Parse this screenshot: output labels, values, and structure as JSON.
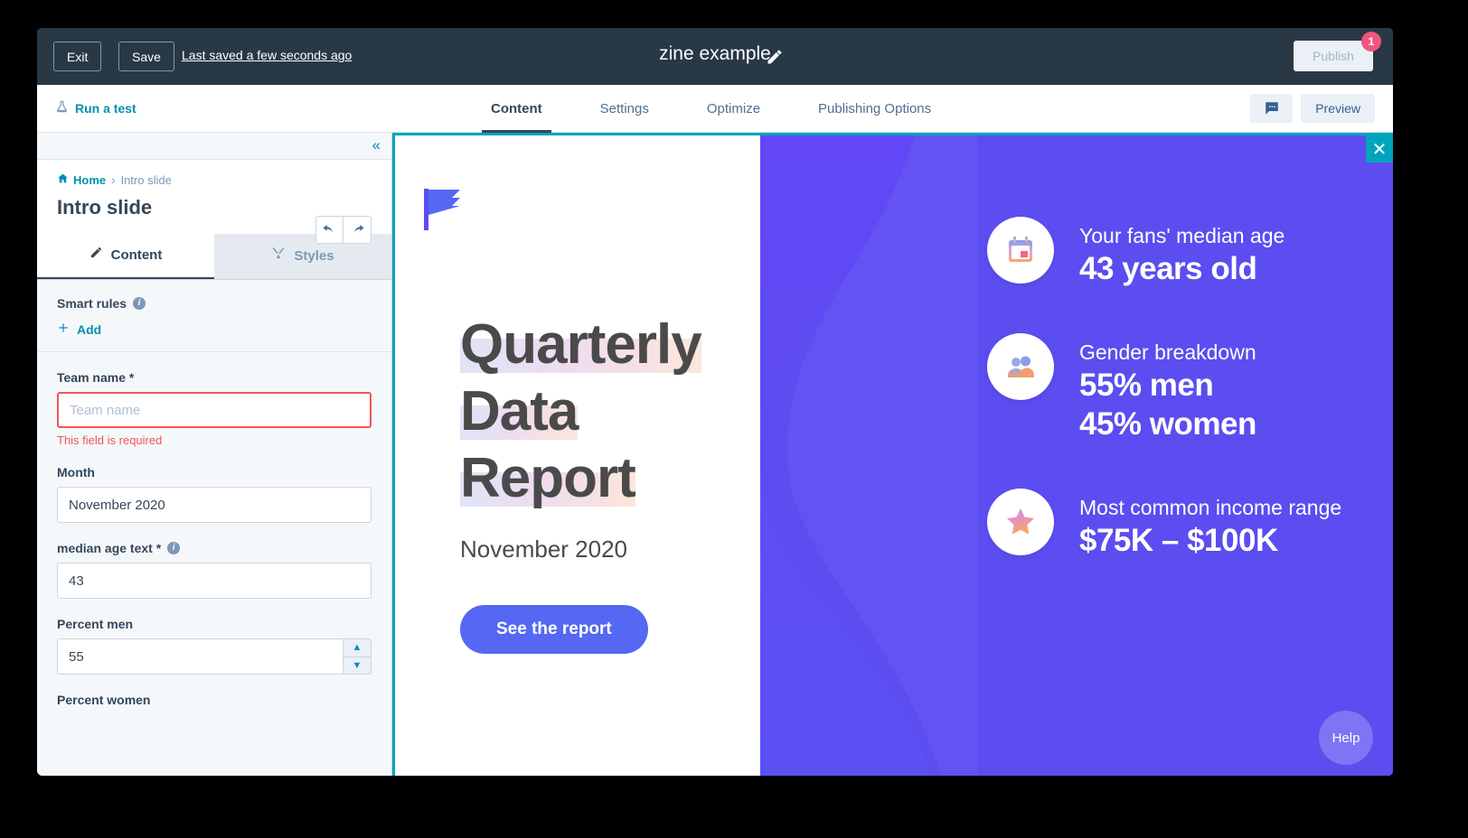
{
  "topbar": {
    "exit_label": "Exit",
    "save_label": "Save",
    "saved_status": "Last saved a few seconds ago",
    "title": "zine example",
    "edit_icon": "pencil-icon",
    "publish_label": "Publish",
    "publish_badge": "1"
  },
  "navbar": {
    "run_test_label": "Run a test",
    "run_test_icon": "flask-icon",
    "tabs": [
      {
        "label": "Content",
        "active": true
      },
      {
        "label": "Settings",
        "active": false
      },
      {
        "label": "Optimize",
        "active": false
      },
      {
        "label": "Publishing Options",
        "active": false
      }
    ],
    "comment_icon": "comment-bubble-icon",
    "preview_label": "Preview"
  },
  "sidebar": {
    "collapse_icon": "chevron-double-left-icon",
    "breadcrumb": {
      "home": "Home",
      "separator": "›",
      "current": "Intro slide",
      "home_icon": "home-icon"
    },
    "title": "Intro slide",
    "undo_icon": "undo-arrow-icon",
    "redo_icon": "redo-arrow-icon",
    "tabs": [
      {
        "label": "Content",
        "icon": "pencil-icon",
        "active": true
      },
      {
        "label": "Styles",
        "icon": "paintbrush-icon",
        "active": false
      }
    ],
    "smart_rules": {
      "label": "Smart rules",
      "info_icon": "info-icon",
      "add_label": "Add",
      "add_icon": "plus-icon"
    },
    "fields": [
      {
        "label": "Team name *",
        "value": "",
        "placeholder": "Team name",
        "error": "This field is required",
        "type": "text"
      },
      {
        "label": "Month",
        "value": "November 2020",
        "placeholder": "",
        "type": "text"
      },
      {
        "label": "median age text *",
        "value": "43",
        "placeholder": "",
        "info_icon": "info-icon",
        "type": "text"
      },
      {
        "label": "Percent men",
        "value": "55",
        "placeholder": "",
        "type": "number"
      },
      {
        "label": "Percent women",
        "value": "",
        "placeholder": "",
        "type": "text"
      }
    ]
  },
  "preview": {
    "close_icon": "close-x-icon",
    "logo_icon": "flag-icon",
    "headline_lines": [
      "Quarterly",
      "Data",
      "Report"
    ],
    "subtitle": "November 2020",
    "cta_label": "See the report",
    "stats": [
      {
        "icon": "calendar-icon",
        "label": "Your fans' median age",
        "value": "43 years old"
      },
      {
        "icon": "people-icon",
        "label": "Gender breakdown",
        "value": "55% men",
        "value2": "45% women"
      },
      {
        "icon": "star-icon",
        "label": "Most common income range",
        "value": "$75K – $100K"
      }
    ],
    "help_label": "Help",
    "accent_purple": "#5b4df0",
    "accent_blue": "#5468f3",
    "accent_teal": "#00a4bd"
  }
}
